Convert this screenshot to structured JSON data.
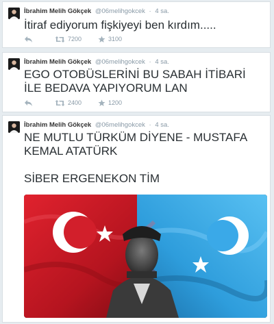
{
  "tweets": [
    {
      "author_name": "İbrahim Melih Gökçek",
      "handle": "@06melihgokcek",
      "separator": "·",
      "time": "4 sa.",
      "text": "İtiraf ediyorum fişkiyeyi ben kırdım.....",
      "retweets": "7200",
      "favorites": "3100"
    },
    {
      "author_name": "İbrahim Melih Gökçek",
      "handle": "@06melihgokcek",
      "separator": "·",
      "time": "4 sa.",
      "text": "EGO OTOBÜSLERİNİ BU SABAH İTİBARİ İLE BEDAVA YAPIYORUM LAN",
      "retweets": "2400",
      "favorites": "1200"
    },
    {
      "author_name": "İbrahim Melih Gökçek",
      "handle": "@06melihgokcek",
      "separator": "·",
      "time": "4 sa.",
      "text_line1": "NE MUTLU TÜRKÜM DİYENE - MUSTAFA KEMAL ATATÜRK",
      "text_line2": "SİBER ERGENEKON TİM"
    }
  ],
  "icons": {
    "reply": "reply-icon",
    "retweet": "retweet-icon",
    "favorite": "star-icon"
  },
  "colors": {
    "background": "#e6ecf0",
    "text": "#292f33",
    "meta": "#8899a6",
    "turkish_flag_red": "#d21f2b",
    "east_turkestan_blue": "#3aa9e8"
  }
}
